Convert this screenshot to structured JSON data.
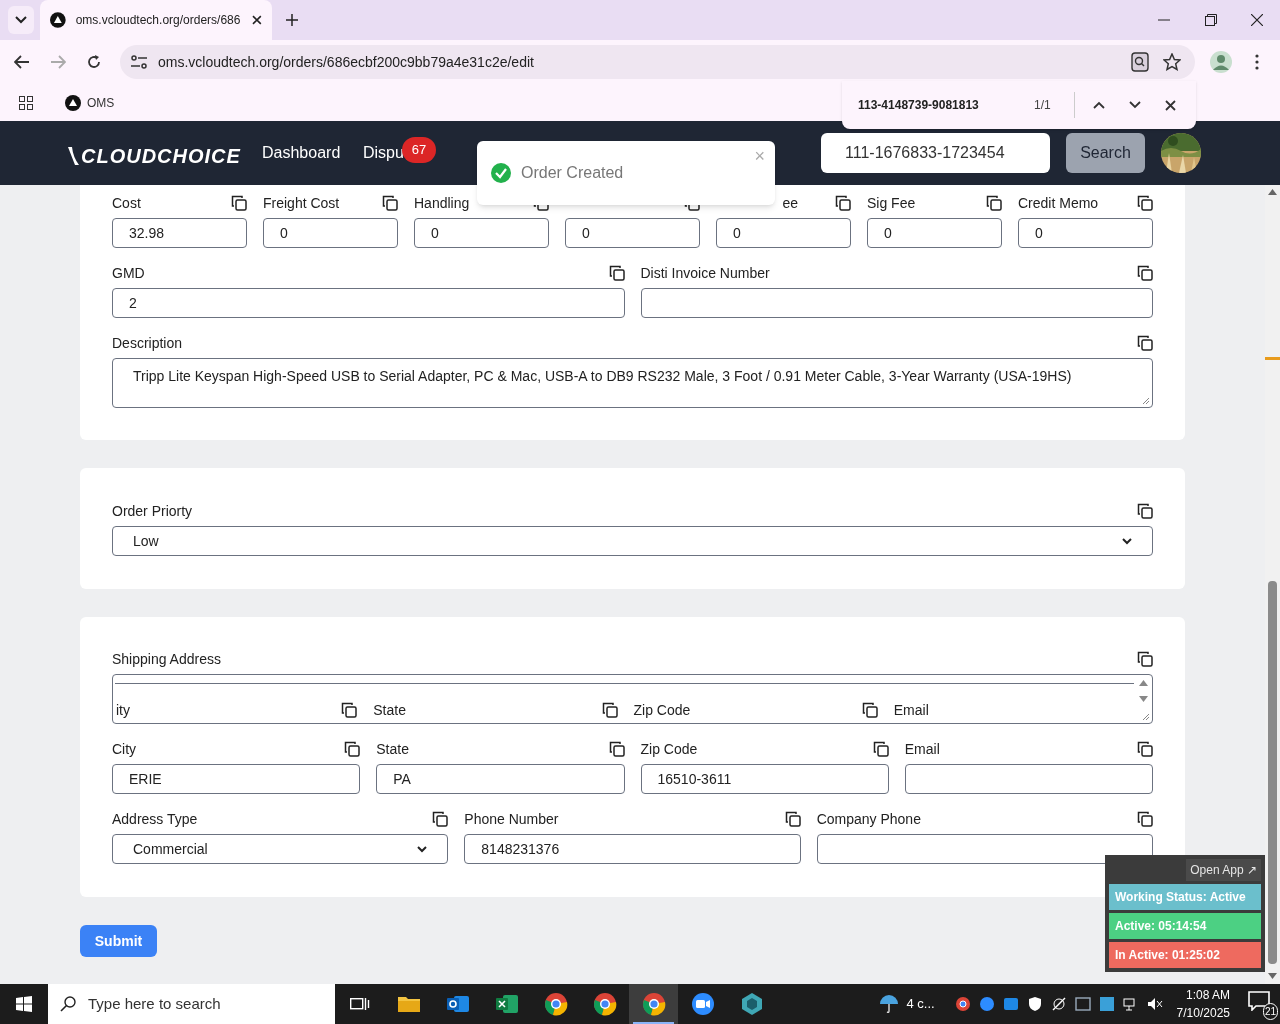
{
  "browser": {
    "tab_title": "oms.vcloudtech.org/orders/686",
    "url": "oms.vcloudtech.org/orders/686ecbf200c9bb79a4e31c2e/edit",
    "bookmarks": [
      {
        "label": "OMS"
      }
    ],
    "find_bar": {
      "query": "113-4148739-9081813",
      "count": "1/1"
    }
  },
  "header": {
    "logo": "CLOUDCHOICE",
    "nav": [
      {
        "label": "Dashboard"
      },
      {
        "label": "Dispu",
        "badge": "67"
      }
    ],
    "search": {
      "value": "111-1676833-1723454",
      "button": "Search"
    }
  },
  "toast": {
    "message": "Order Created",
    "close": "×"
  },
  "cards": [
    {
      "rows": [
        [
          {
            "kind": "input",
            "label": "Cost",
            "value": "32.98"
          },
          {
            "kind": "input",
            "label": "Freight Cost",
            "value": "0"
          },
          {
            "kind": "input",
            "label": "Handling",
            "value": "0"
          },
          {
            "kind": "input",
            "value": "0"
          },
          {
            "kind": "input",
            "label": "ee",
            "label_clipped": true,
            "value": "0"
          },
          {
            "kind": "input",
            "label": "Sig Fee",
            "value": "0"
          },
          {
            "kind": "input",
            "label": "Credit Memo",
            "value": "0"
          }
        ],
        [
          {
            "kind": "input",
            "label": "GMD",
            "value": "2"
          },
          {
            "kind": "input",
            "label": "Disti Invoice Number"
          }
        ],
        [
          {
            "kind": "textarea",
            "label": "Description",
            "value": "Tripp Lite Keyspan High-Speed USB to Serial Adapter, PC & Mac, USB-A to DB9 RS232 Male, 3 Foot / 0.91 Meter Cable, 3-Year Warranty (USA-19HS)"
          }
        ]
      ]
    },
    {
      "rows": [
        [
          {
            "kind": "select",
            "label": "Order Priorty",
            "value": "Low"
          }
        ]
      ]
    },
    {
      "rows": [
        [
          {
            "kind": "embedded",
            "label": "Shipping Address",
            "inner_labels": [
              "ity",
              "State",
              "Zip Code",
              "Email"
            ]
          }
        ],
        [
          {
            "kind": "input",
            "label": "City",
            "value": "ERIE"
          },
          {
            "kind": "input",
            "label": "State",
            "value": "PA"
          },
          {
            "kind": "input",
            "label": "Zip Code",
            "value": "16510-3611"
          },
          {
            "kind": "input",
            "label": "Email"
          }
        ],
        [
          {
            "kind": "select",
            "label": "Address Type",
            "value": "Commercial"
          },
          {
            "kind": "input",
            "label": "Phone Number",
            "value": "8148231376"
          },
          {
            "kind": "input",
            "label": "Company Phone"
          }
        ]
      ]
    }
  ],
  "submit": "Submit",
  "status_widget": {
    "open_app": "Open App ↗",
    "items": [
      {
        "text": "Working Status: Active",
        "color": "#6bbfcc"
      },
      {
        "text": "Active: 05:14:54",
        "color": "#4cd083"
      },
      {
        "text": "In Active: 01:25:02",
        "color": "#ee6a5f"
      }
    ]
  },
  "taskbar": {
    "search_placeholder": "Type here to search",
    "apps": [
      {
        "kind": "taskview",
        "active": false
      },
      {
        "kind": "folder",
        "active": false
      },
      {
        "kind": "outlook",
        "active": false
      },
      {
        "kind": "excel",
        "active": false
      },
      {
        "kind": "chrome",
        "active": false
      },
      {
        "kind": "chrome",
        "active": false
      },
      {
        "kind": "chrome",
        "active": true
      },
      {
        "kind": "zoom",
        "active": false
      },
      {
        "kind": "app",
        "active": false
      }
    ],
    "weather": "4 c...",
    "time": "1:08 AM",
    "date": "7/10/2025",
    "notifications": "21"
  }
}
